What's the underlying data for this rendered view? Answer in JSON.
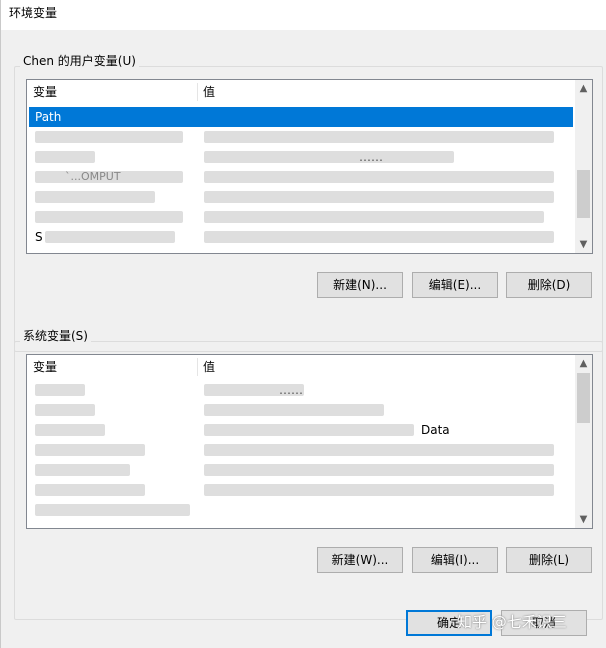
{
  "window": {
    "title": "环境变量"
  },
  "user_vars": {
    "group_label": "Chen 的用户变量(U)",
    "col_variable": "变量",
    "col_value": "值",
    "rows": [
      {
        "name": "Path",
        "value": "",
        "selected": true
      },
      {
        "name": "",
        "value": "",
        "selected": false
      },
      {
        "name": "",
        "value": "……",
        "selected": false
      },
      {
        "name": "`...OMPUT",
        "value": "",
        "selected": false
      },
      {
        "name": "",
        "value": "",
        "selected": false
      },
      {
        "name": "",
        "value": "",
        "selected": false
      },
      {
        "name": "S",
        "value": "",
        "selected": false
      }
    ],
    "buttons": {
      "new": "新建(N)...",
      "edit": "编辑(E)...",
      "delete": "删除(D)"
    }
  },
  "system_vars": {
    "group_label": "系统变量(S)",
    "col_variable": "变量",
    "col_value": "值",
    "rows": [
      {
        "name": "",
        "value": "……",
        "selected": false
      },
      {
        "name": "",
        "value": "",
        "selected": false
      },
      {
        "name": "",
        "value": "Data",
        "selected": false
      },
      {
        "name": "",
        "value": "",
        "selected": false
      },
      {
        "name": "",
        "value": "",
        "selected": false
      },
      {
        "name": "",
        "value": "",
        "selected": false
      },
      {
        "name": "",
        "value": "",
        "selected": false
      }
    ],
    "buttons": {
      "new": "新建(W)...",
      "edit": "编辑(I)...",
      "delete": "删除(L)"
    }
  },
  "footer": {
    "ok": "确定",
    "cancel": "取消"
  },
  "watermark": "知乎 @七禾识三"
}
